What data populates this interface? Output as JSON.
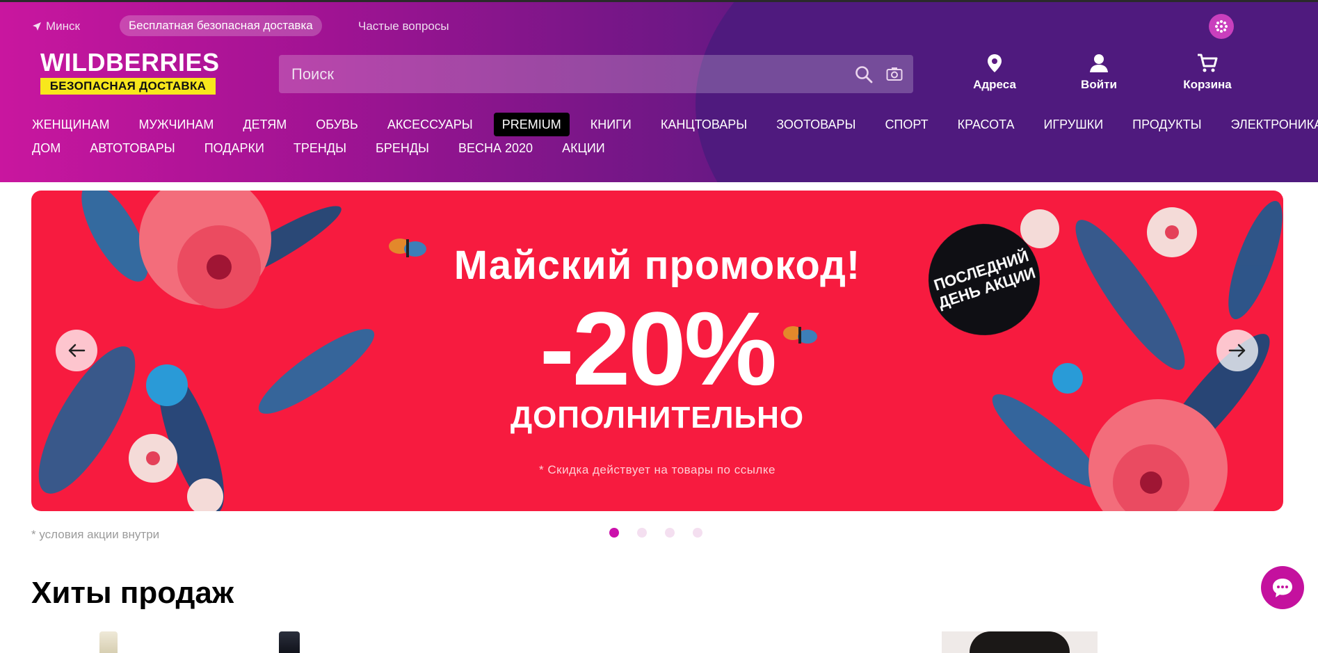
{
  "header": {
    "city": "Минск",
    "delivery_pill": "Бесплатная безопасная доставка",
    "faq": "Частые вопросы",
    "logo_word": "WILDBERRIES",
    "logo_tag": "БЕЗОПАСНАЯ ДОСТАВКА",
    "search_placeholder": "Поиск",
    "actions": {
      "addresses": "Адреса",
      "login": "Войти",
      "cart": "Корзина"
    }
  },
  "nav": {
    "row1": [
      "ЖЕНЩИНАМ",
      "МУЖЧИНАМ",
      "ДЕТЯМ",
      "ОБУВЬ",
      "АКСЕССУАРЫ",
      "PREMIUM",
      "КНИГИ",
      "КАНЦТОВАРЫ",
      "ЗООТОВАРЫ",
      "СПОРТ",
      "КРАСОТА",
      "ИГРУШКИ",
      "ПРОДУКТЫ",
      "ЭЛЕКТРОНИКА"
    ],
    "row2": [
      "ДОМ",
      "АВТОТОВАРЫ",
      "ПОДАРКИ",
      "ТРЕНДЫ",
      "БРЕНДЫ",
      "ВЕСНА 2020",
      "АКЦИИ"
    ]
  },
  "banner": {
    "title": "Майский промокод!",
    "percent": "-20%",
    "subtitle": "ДОПОЛНИТЕЛЬНО",
    "note": "* Скидка действует на товары по ссылке",
    "badge": "ПОСЛЕДНИЙ ДЕНЬ АКЦИИ",
    "slide_count": 4,
    "active_slide": 1
  },
  "promo_note": "* условия акции внутри",
  "section_title": "Хиты продаж",
  "colors": {
    "brand": "#cb11ab",
    "header_dark": "#4e1880",
    "banner_red": "#f71b3f",
    "logo_yellow": "#f8e71c"
  },
  "icons": [
    "location-arrow-icon",
    "language-icon",
    "search-icon",
    "camera-icon",
    "map-pin-icon",
    "user-icon",
    "cart-icon",
    "arrow-left-icon",
    "arrow-right-icon",
    "chat-icon"
  ]
}
